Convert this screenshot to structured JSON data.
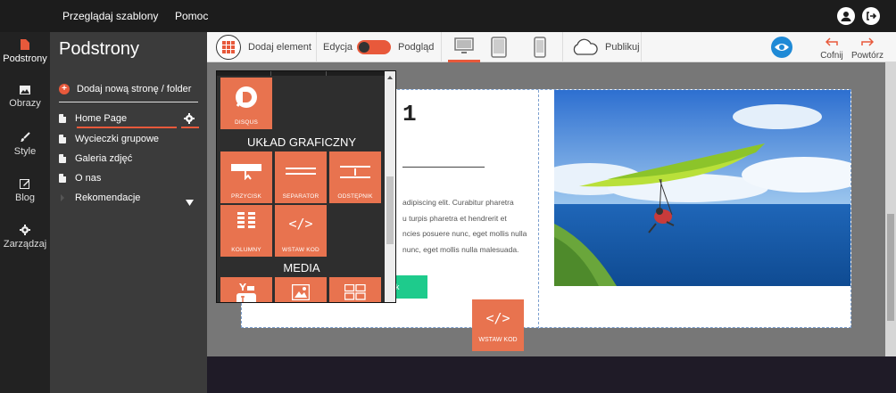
{
  "topbar": {
    "nav_browse": "Przeglądaj szablony",
    "nav_help": "Pomoc"
  },
  "rail": {
    "items": [
      {
        "label": "Podstrony",
        "icon": "page-icon"
      },
      {
        "label": "Obrazy",
        "icon": "image-icon"
      },
      {
        "label": "Style",
        "icon": "brush-icon"
      },
      {
        "label": "Blog",
        "icon": "edit-icon"
      },
      {
        "label": "Zarządzaj",
        "icon": "gear-icon"
      }
    ]
  },
  "panel": {
    "title": "Podstrony",
    "add_label": "Dodaj nową stronę / folder",
    "pages": [
      {
        "label": "Home Page",
        "active": true
      },
      {
        "label": "Wycieczki grupowe"
      },
      {
        "label": "Galeria zdjęć"
      },
      {
        "label": "O nas"
      },
      {
        "label": "Rekomendacje",
        "folder": true
      }
    ]
  },
  "toolbar": {
    "add_element": "Dodaj element",
    "edit": "Edycja",
    "preview": "Podgląd",
    "publish": "Publikuj",
    "undo": "Cofnij",
    "redo": "Powtórz"
  },
  "canvas": {
    "heading": "1",
    "para_lines": [
      "adipiscing elit. Curabitur pharetra",
      "u turpis pharetra et hendrerit et",
      "ncies posuere nunc, eget mollis nulla",
      "nunc, eget mollis nulla malesuada."
    ],
    "button_text": "k"
  },
  "dropdown": {
    "disqus_label": "DISQUS",
    "section_layout": "UKŁAD GRAFICZNY",
    "tiles_layout": [
      "PRZYCISK",
      "SEPARATOR",
      "ODSTĘPNIK",
      "KOLUMNY",
      "WSTAW KOD"
    ],
    "section_media": "MEDIA"
  },
  "floating_tile": {
    "label": "WSTAW KOD",
    "glyph": "</>"
  },
  "colors": {
    "accent": "#e8593b",
    "tile": "#e8734f",
    "preview_blue": "#1f8ad6"
  }
}
